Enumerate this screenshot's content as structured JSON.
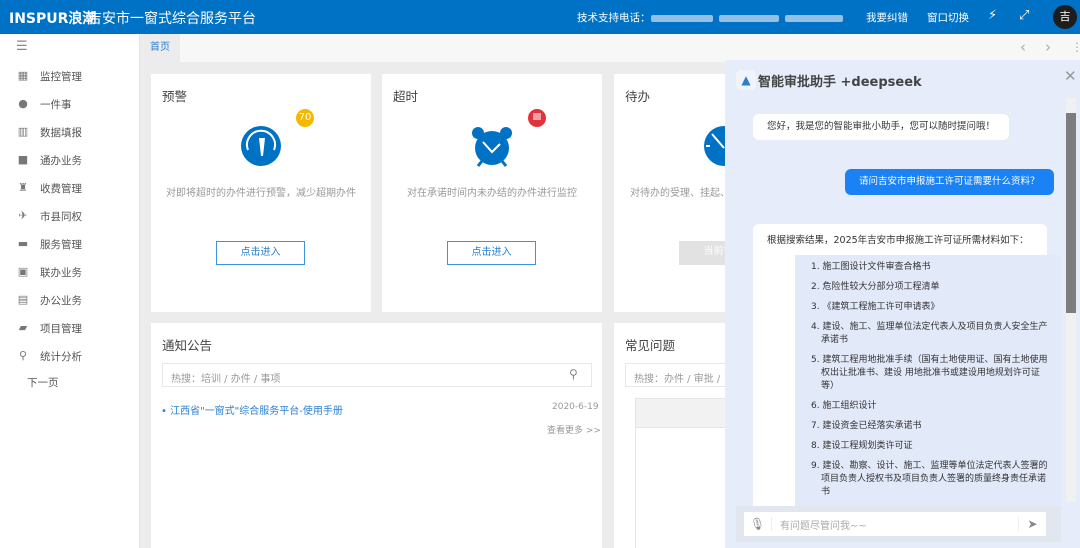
{
  "header": {
    "brand": "INSPUR浪潮",
    "title": "吉安市一窗式综合服务平台",
    "support_label": "技术支持电话：",
    "report_error": "我要纠错",
    "switch_window": "窗口切换",
    "avatar_text": "吉"
  },
  "sidebar": {
    "items": [
      {
        "label": "监控管理",
        "icon": "grid-icon"
      },
      {
        "label": "一件事",
        "icon": "user-circle-icon"
      },
      {
        "label": "数据填报",
        "icon": "building-icon"
      },
      {
        "label": "通办业务",
        "icon": "briefcase-icon"
      },
      {
        "label": "收费管理",
        "icon": "android-icon"
      },
      {
        "label": "市县同权",
        "icon": "airplane-icon"
      },
      {
        "label": "服务管理",
        "icon": "store-icon"
      },
      {
        "label": "联办业务",
        "icon": "google-plus-icon"
      },
      {
        "label": "办公业务",
        "icon": "list-icon"
      },
      {
        "label": "项目管理",
        "icon": "folder-user-icon"
      },
      {
        "label": "统计分析",
        "icon": "search-icon"
      }
    ],
    "next_page": "下一页"
  },
  "tabs": [
    {
      "label": "首页"
    }
  ],
  "cards": [
    {
      "title": "预警",
      "badge": "70",
      "badge_color": "#f5b800",
      "desc": "对即将超时的办件进行预警，减少超期办件",
      "button": "点击进入"
    },
    {
      "title": "超时",
      "badge": "",
      "badge_color": "#e0343d",
      "desc": "对在承诺时间内未办结的办件进行监控",
      "button": "点击进入"
    },
    {
      "title": "待办",
      "desc": "对待办的受理、挂起、",
      "button": "当前暂无"
    }
  ],
  "notice": {
    "title": "通知公告",
    "search_placeholder": "热搜：培训 / 办件 / 事项",
    "items": [
      {
        "title": "江西省\"一窗式\"综合服务平台-使用手册",
        "date": "2020-6-19"
      }
    ],
    "more": "查看更多 >>"
  },
  "faq": {
    "title": "常见问题",
    "search_placeholder": "热搜：办件 / 审批 / "
  },
  "chat": {
    "title": "智能审批助手 +deepseek",
    "greeting": "您好，我是您的智能审批小助手，您可以随时提问哦！",
    "question": "请问吉安市申报施工许可证需要什么资料？",
    "answer_intro": "根据搜索结果，2025年吉安市申报施工许可证所需材料如下：",
    "answer_items": [
      "1. 施工图设计文件审查合格书",
      "2. 危险性较大分部分项工程清单",
      "3. 《建筑工程施工许可申请表》",
      "4. 建设、施工、监理单位法定代表人及项目负责人安全生产承诺书",
      "5. 建筑工程用地批准手续（国有土地使用证、国有土地使用权出让批准书、建设 用地批准书或建设用地规划许可证等）",
      "6. 施工组织设计",
      "7. 建设资金已经落实承诺书",
      "8. 建设工程规划类许可证",
      "9. 建设、勘察、设计、施工、监理等单位法定代表人签署的项目负责人授权书及项目负责人签署的质量终身责任承诺书"
    ],
    "input_placeholder": "有问题尽管问我~~"
  }
}
